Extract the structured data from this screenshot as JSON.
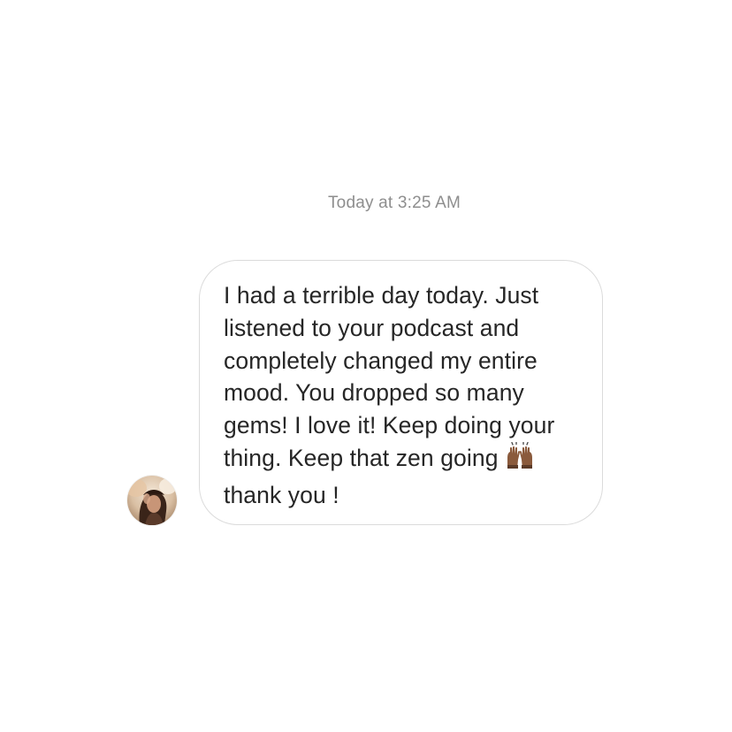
{
  "conversation": {
    "timestamp": "Today at 3:25 AM",
    "message": {
      "lines": [
        "I had a terrible day today. Just",
        "listened to your podcast and",
        "completely changed my entire",
        "mood. You dropped so many",
        "gems! I love it! Keep doing your",
        "thing. Keep that zen going",
        "thank you !"
      ],
      "emoji": "raising-hands-emoji-medium-dark-skin"
    },
    "sender": {
      "avatar": "profile-photo"
    }
  }
}
